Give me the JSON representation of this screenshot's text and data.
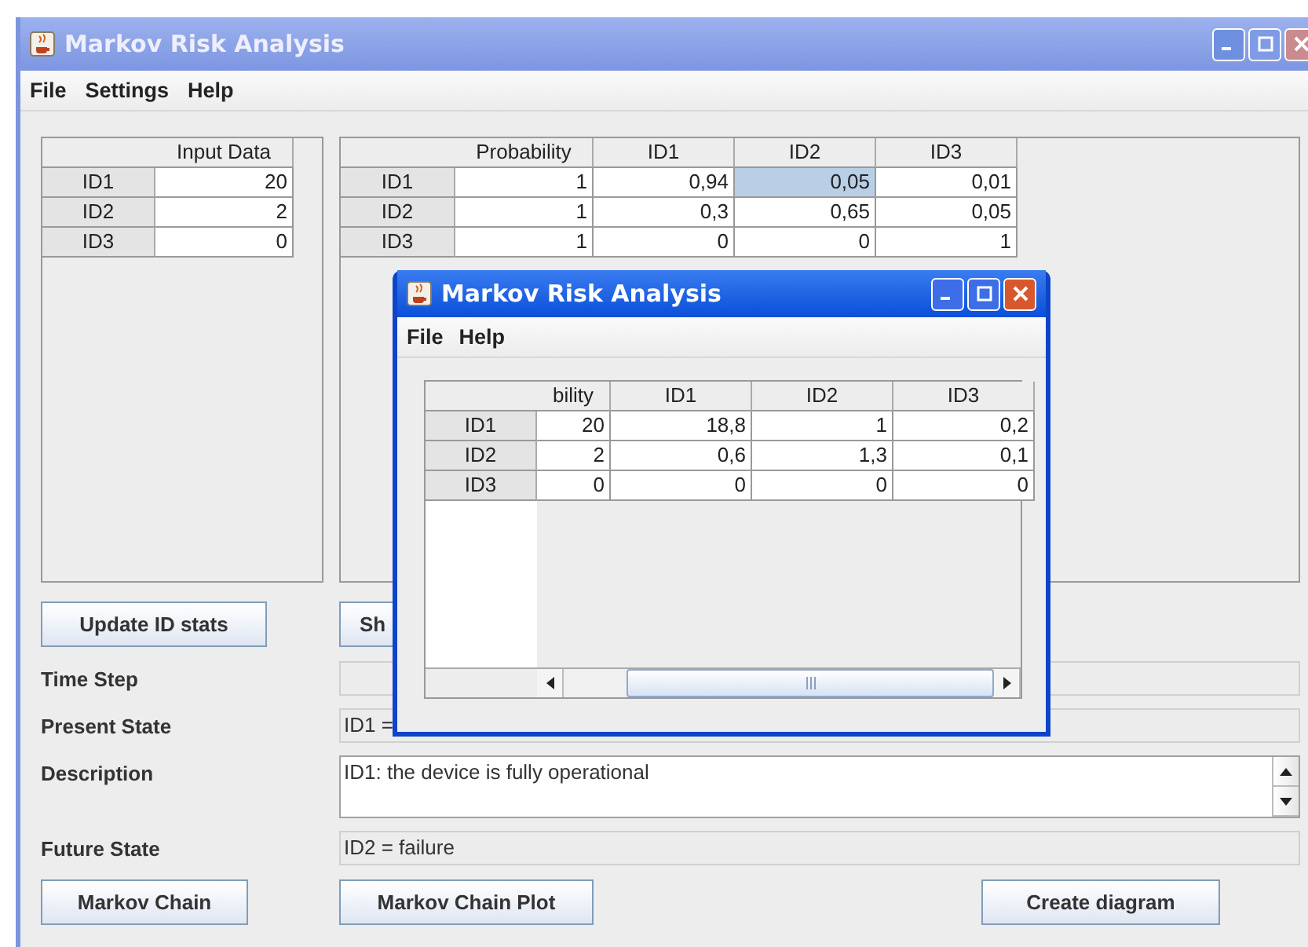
{
  "main_window": {
    "title": "Markov Risk Analysis",
    "menu": [
      "File",
      "Settings",
      "Help"
    ],
    "input_table": {
      "columns": [
        "Input Data"
      ],
      "rows": [
        {
          "header": "ID1",
          "cells": [
            "20"
          ]
        },
        {
          "header": "ID2",
          "cells": [
            "2"
          ]
        },
        {
          "header": "ID3",
          "cells": [
            "0"
          ]
        }
      ]
    },
    "probability_table": {
      "columns": [
        "Probability",
        "ID1",
        "ID2",
        "ID3"
      ],
      "rows": [
        {
          "header": "ID1",
          "cells": [
            {
              "text": "1",
              "selected": false
            },
            {
              "text": "0,94",
              "selected": false
            },
            {
              "text": "0,05",
              "selected": true
            },
            {
              "text": "0,01",
              "selected": false
            }
          ]
        },
        {
          "header": "ID2",
          "cells": [
            {
              "text": "1",
              "selected": false
            },
            {
              "text": "0,3",
              "selected": false
            },
            {
              "text": "0,65",
              "selected": false
            },
            {
              "text": "0,05",
              "selected": false
            }
          ]
        },
        {
          "header": "ID3",
          "cells": [
            {
              "text": "1",
              "selected": false
            },
            {
              "text": "0",
              "selected": false
            },
            {
              "text": "0",
              "selected": false
            },
            {
              "text": "1",
              "selected": false
            }
          ]
        }
      ]
    },
    "top_buttons": [
      "Update ID stats",
      "Sh"
    ],
    "fields": [
      {
        "kind": "field",
        "label": "Time Step"
      },
      {
        "kind": "field",
        "label": "Present State",
        "value": "ID1 ="
      },
      {
        "kind": "textarea",
        "label": "Description",
        "value": "ID1: the device is fully operational"
      },
      {
        "kind": "field",
        "label": "Future State",
        "value": "ID2 = failure"
      }
    ],
    "bottom_buttons": [
      "Markov Chain",
      "Markov Chain Plot",
      "Create diagram"
    ]
  },
  "dialog": {
    "title": "Markov Risk Analysis",
    "menu": [
      "File",
      "Help"
    ],
    "table": {
      "columns": [
        "bility",
        "ID1",
        "ID2",
        "ID3"
      ],
      "rows": [
        {
          "header": "ID1",
          "cells": [
            "20",
            "18,8",
            "1",
            "0,2"
          ]
        },
        {
          "header": "ID2",
          "cells": [
            "2",
            "0,6",
            "1,3",
            "0,1"
          ]
        },
        {
          "header": "ID3",
          "cells": [
            "0",
            "0",
            "0",
            "0"
          ]
        }
      ]
    }
  }
}
